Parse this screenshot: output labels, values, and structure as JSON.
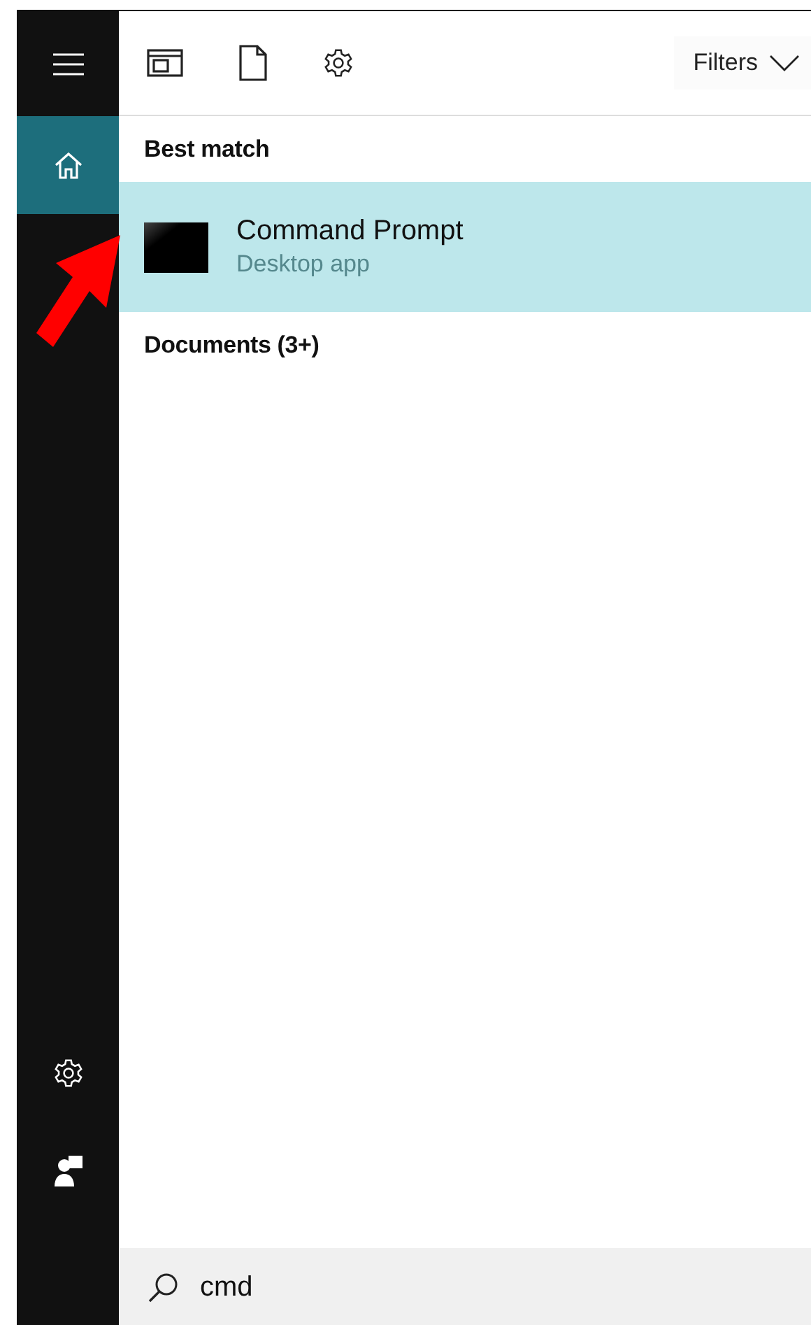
{
  "sidebar": {
    "items": [
      {
        "kind": "menu",
        "selected": false
      },
      {
        "kind": "home",
        "selected": true
      }
    ],
    "bottom_items": [
      {
        "kind": "settings"
      },
      {
        "kind": "user"
      }
    ]
  },
  "toolbar": {
    "icons": [
      {
        "kind": "apps"
      },
      {
        "kind": "documents"
      },
      {
        "kind": "settings"
      }
    ],
    "filters": "Filters"
  },
  "sections": [
    {
      "heading": "Best match",
      "results": [
        {
          "title": "Command Prompt",
          "subtitle": "Desktop app",
          "selected": true
        }
      ]
    },
    {
      "heading": "Documents (3+)"
    }
  ],
  "annotation": {
    "kind": "arrow"
  },
  "search": {
    "value": "cmd"
  }
}
